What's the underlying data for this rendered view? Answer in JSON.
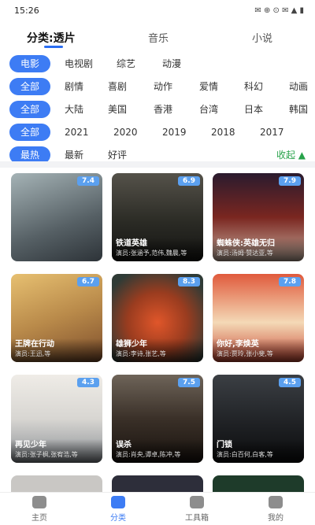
{
  "status_bar": {
    "time": "15:26",
    "icons": "✉ ⊕ ⊙ ✉ ▲ ▮"
  },
  "top_tabs": [
    {
      "label": "分类:透片",
      "active": true
    },
    {
      "label": "音乐",
      "active": false
    },
    {
      "label": "小说",
      "active": false
    }
  ],
  "filters": [
    {
      "pill": "电影",
      "options": [
        "电视剧",
        "综艺",
        "动漫"
      ]
    },
    {
      "pill": "全部",
      "options": [
        "剧情",
        "喜剧",
        "动作",
        "爱情",
        "科幻",
        "动画"
      ]
    },
    {
      "pill": "全部",
      "options": [
        "大陆",
        "美国",
        "香港",
        "台湾",
        "日本",
        "韩国"
      ]
    },
    {
      "pill": "全部",
      "options": [
        "2021",
        "2020",
        "2019",
        "2018",
        "2017"
      ]
    },
    {
      "pill": "最热",
      "options": [
        "最新",
        "好评"
      ]
    }
  ],
  "collapse_label": "收起 ▲",
  "movies": [
    {
      "score": "7.4",
      "title": "",
      "subtitle": "",
      "bg": "#7c8a8e"
    },
    {
      "score": "6.9",
      "title": "铁道英雄",
      "subtitle": "演员:张涵予,范伟,魏晨,等",
      "bg": "#2b2b25"
    },
    {
      "score": "7.9",
      "title": "蜘蛛侠:英雄无归",
      "subtitle": "演员:汤姆·赞达亚,等",
      "bg": "#7a2620"
    },
    {
      "score": "6.7",
      "title": "王牌在行动",
      "subtitle": "演员:王迅,等",
      "bg": "#b98a4a"
    },
    {
      "score": "8.3",
      "title": "雄狮少年",
      "subtitle": "演员:李诗,张艺,等",
      "bg": "#9a3c1f"
    },
    {
      "score": "7.8",
      "title": "你好,李焕英",
      "subtitle": "演员:贾玲,张小斐,等",
      "bg": "#c94a36"
    },
    {
      "score": "4.3",
      "title": "再见少年",
      "subtitle": "演员:张子枫,张宥浩,等",
      "bg": "#d8d6d2"
    },
    {
      "score": "7.5",
      "title": "误杀",
      "subtitle": "演员:肖央,谭卓,陈冲,等",
      "bg": "#3a3028"
    },
    {
      "score": "4.5",
      "title": "门锁",
      "subtitle": "演员:白百何,白客,等",
      "bg": "#1d1f22"
    }
  ],
  "bottom_nav": [
    {
      "label": "主页",
      "active": false
    },
    {
      "label": "分类",
      "active": true
    },
    {
      "label": "工具箱",
      "active": false
    },
    {
      "label": "我的",
      "active": false
    }
  ]
}
